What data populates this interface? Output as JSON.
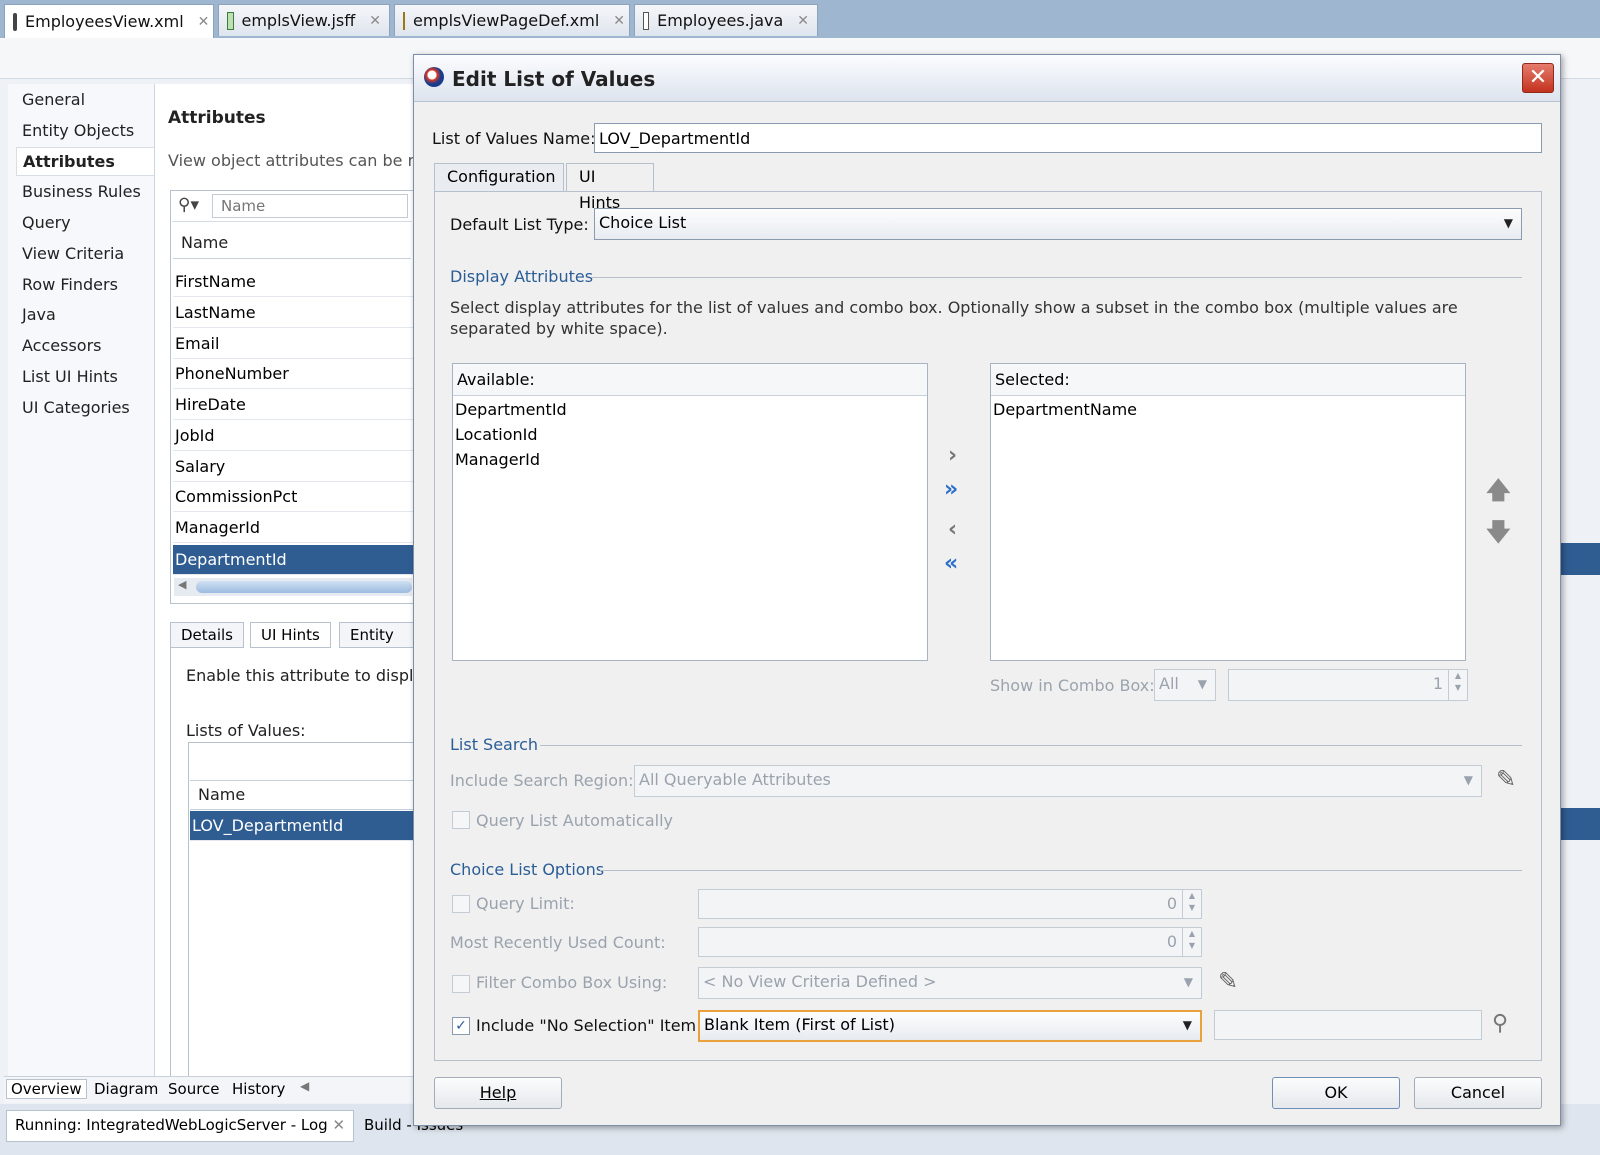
{
  "editor_tabs": [
    {
      "label": "EmployeesView.xml",
      "icon": "view-object-icon",
      "active": true
    },
    {
      "label": "emplsView.jsff",
      "icon": "jsff-icon",
      "active": false
    },
    {
      "label": "emplsViewPageDef.xml",
      "icon": "pagedef-icon",
      "active": false
    },
    {
      "label": "Employees.java",
      "icon": "java-file-icon",
      "active": false
    }
  ],
  "left_nav": {
    "items": [
      "General",
      "Entity Objects",
      "Attributes",
      "Business Rules",
      "Query",
      "View Criteria",
      "Row Finders",
      "Java",
      "Accessors",
      "List UI Hints",
      "UI Categories"
    ],
    "selected": "Attributes"
  },
  "attributes_panel": {
    "title": "Attributes",
    "description": "View object attributes can be ma",
    "search_placeholder": "Name",
    "column_header": "Name",
    "rows": [
      "FirstName",
      "LastName",
      "Email",
      "PhoneNumber",
      "HireDate",
      "JobId",
      "Salary",
      "CommissionPct",
      "ManagerId",
      "DepartmentId"
    ],
    "selected_row": "DepartmentId",
    "bottom_tabs": [
      "Details",
      "UI Hints",
      "Entity A"
    ],
    "enable_text": "Enable this attribute to display",
    "lov_label": "Lists of Values:",
    "lov_column": "Name",
    "lov_rows": [
      "LOV_DepartmentId"
    ]
  },
  "view_tabs": [
    "Overview",
    "Diagram",
    "Source",
    "History"
  ],
  "log_tabs": [
    "Running: IntegratedWebLogicServer - Log",
    "Build - Issues"
  ],
  "dialog": {
    "title": "Edit List of Values",
    "close_label": "✕",
    "lov_name_label": "List of Values Name:",
    "lov_name_value": "LOV_DepartmentId",
    "tabs": [
      "Configuration",
      "UI Hints"
    ],
    "active_tab": "UI Hints",
    "default_list_type_label": "Default List Type:",
    "default_list_type_value": "Choice List",
    "display_attributes": {
      "heading": "Display Attributes",
      "description": "Select display attributes for the list of values and combo box. Optionally show a subset in the combo box (multiple values are separated by white space).",
      "available_label": "Available:",
      "available": [
        "DepartmentId",
        "LocationId",
        "ManagerId"
      ],
      "selected_label": "Selected:",
      "selected": [
        "DepartmentName"
      ],
      "show_in_combo_label": "Show in Combo Box:",
      "show_in_combo_value": "All",
      "show_in_combo_count": "1"
    },
    "list_search": {
      "heading": "List Search",
      "include_search_region_label": "Include Search Region:",
      "include_search_region_value": "All Queryable Attributes",
      "query_automatically_label": "Query List Automatically",
      "query_automatically_checked": false
    },
    "choice_list_options": {
      "heading": "Choice List Options",
      "query_limit_label": "Query Limit:",
      "query_limit_value": "0",
      "query_limit_checked": false,
      "mru_label": "Most Recently Used Count:",
      "mru_value": "0",
      "filter_label": "Filter Combo Box Using:",
      "filter_value": "< No View Criteria Defined >",
      "filter_checked": false,
      "no_selection_label": "Include \"No Selection\" Item:",
      "no_selection_checked": true,
      "no_selection_value": "Blank Item (First of List)",
      "no_selection_text": ""
    },
    "buttons": {
      "help": "Help",
      "ok": "OK",
      "cancel": "Cancel"
    }
  }
}
